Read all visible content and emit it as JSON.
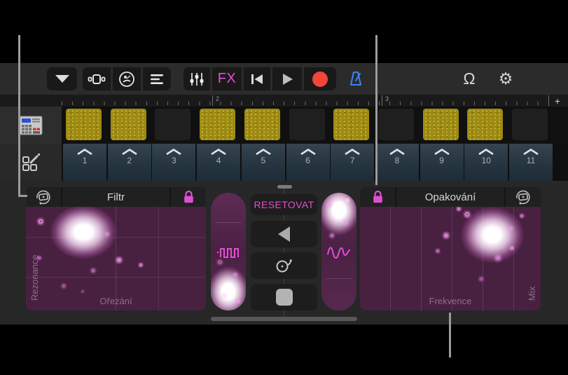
{
  "toolbar": {
    "fx_label": "FX",
    "accent_magenta": "#e24fd4",
    "record_red": "#f3453c",
    "metronome_blue": "#3b82f7"
  },
  "ruler": {
    "bar_labels": [
      {
        "text": "2"
      },
      {
        "text": "3"
      }
    ],
    "add_button_label": "+"
  },
  "grid": {
    "columns": [
      {
        "number": "1",
        "has_loop": true
      },
      {
        "number": "2",
        "has_loop": true
      },
      {
        "number": "3",
        "has_loop": false
      },
      {
        "number": "4",
        "has_loop": true
      },
      {
        "number": "5",
        "has_loop": true
      },
      {
        "number": "6",
        "has_loop": false
      },
      {
        "number": "7",
        "has_loop": true
      },
      {
        "number": "8",
        "has_loop": false
      },
      {
        "number": "9",
        "has_loop": true
      },
      {
        "number": "10",
        "has_loop": true
      },
      {
        "number": "11",
        "has_loop": false
      }
    ]
  },
  "remix_fx": {
    "reset_label": "RESETOVAT",
    "left_pad": {
      "title": "Filtr",
      "x_axis_label": "Ořezání",
      "y_axis_label": "Rezonance"
    },
    "right_pad": {
      "title": "Opakování",
      "x_axis_label": "Frekvence",
      "y_axis_label": "Mix"
    }
  }
}
